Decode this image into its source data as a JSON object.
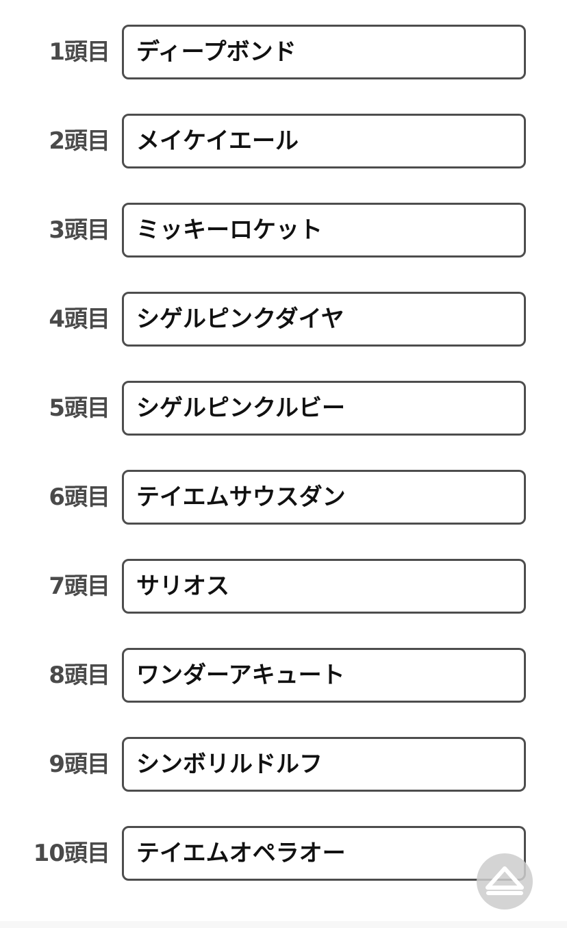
{
  "entries": [
    {
      "label": "1頭目",
      "horse": "ディープボンド"
    },
    {
      "label": "2頭目",
      "horse": "メイケイエール"
    },
    {
      "label": "3頭目",
      "horse": "ミッキーロケット"
    },
    {
      "label": "4頭目",
      "horse": "シゲルピンクダイヤ"
    },
    {
      "label": "5頭目",
      "horse": "シゲルピンクルビー"
    },
    {
      "label": "6頭目",
      "horse": "テイエムサウスダン"
    },
    {
      "label": "7頭目",
      "horse": "サリオス"
    },
    {
      "label": "8頭目",
      "horse": "ワンダーアキュート"
    },
    {
      "label": "9頭目",
      "horse": "シンボリルドルフ"
    },
    {
      "label": "10頭目",
      "horse": "テイエムオペラオー"
    }
  ],
  "scroll_top_button": {
    "icon": "triangle-up-icon"
  },
  "colors": {
    "label_text": "#4a4a4a",
    "field_border": "#4d4d4d",
    "field_text": "#111111",
    "scroll_button_bg": "#cdcdcd"
  }
}
